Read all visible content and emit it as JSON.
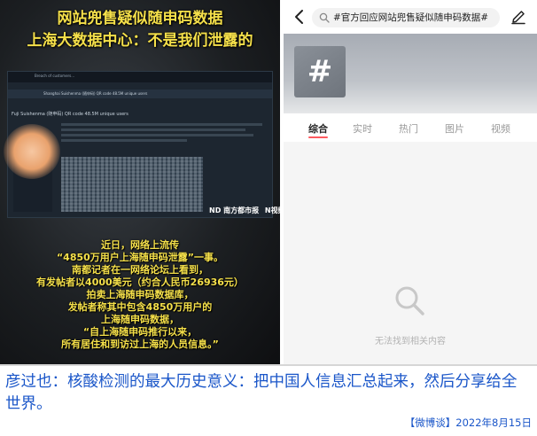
{
  "video": {
    "title_line1": "网站兜售疑似随申码数据",
    "title_line2": "上海大数据中心：不是我们泄露的",
    "forum_topbar_text": "Breach of customers…",
    "forum_nav_text": "Shanghai Suishenma (随申码) QR code 48.5M unique users",
    "forum_post_title": "Fuji Suishenma (随申码) QR code 48.5M unique users",
    "watermark_a": "ND 南方都市报",
    "watermark_b": "N视频",
    "body_lines": [
      "近日，网络上流传",
      "“4850万用户上海随申码泄露”一事。",
      "南都记者在一网络论坛上看到，",
      "有发帖者以4000美元（约合人民币26936元）",
      "拍卖上海随申码数据库，",
      "发帖者称其中包含4850万用户的",
      "上海随申码数据，",
      "“自上海随申码推行以来，",
      "所有居住和到访过上海的人员信息。”"
    ]
  },
  "app": {
    "search_query": "#官方回应网站兜售疑似随申码数据#",
    "topic_symbol": "#",
    "tabs": [
      {
        "label": "综合",
        "active": true
      },
      {
        "label": "实时",
        "active": false
      },
      {
        "label": "热门",
        "active": false
      },
      {
        "label": "图片",
        "active": false
      },
      {
        "label": "视频",
        "active": false
      }
    ],
    "empty_message": "无法找到相关内容",
    "icons": {
      "back": "back-arrow-icon",
      "search": "search-icon",
      "edit": "edit-pen-icon",
      "empty": "magnifier-empty-icon"
    },
    "accent_color": "#ff5a5f"
  },
  "caption": {
    "text": "彦过也：核酸检测的最大历史意义：把中国人信息汇总起来，然后分享给全世界。",
    "source": "【微博谈】2022年8月15日",
    "color": "#1a56c9"
  }
}
